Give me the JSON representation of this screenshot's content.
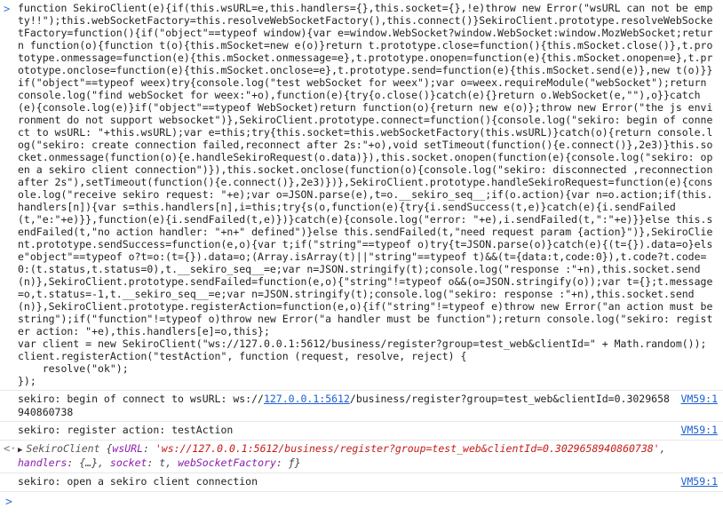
{
  "input_gutter": ">",
  "result_gutter": "<·",
  "prompt_glyph": ">",
  "code_block": "function SekiroClient(e){if(this.wsURL=e,this.handlers={},this.socket={},!e)throw new Error(\"wsURL can not be empty!!\");this.webSocketFactory=this.resolveWebSocketFactory(),this.connect()}SekiroClient.prototype.resolveWebSocketFactory=function(){if(\"object\"==typeof window){var e=window.WebSocket?window.WebSocket:window.MozWebSocket;return function(o){function t(o){this.mSocket=new e(o)}return t.prototype.close=function(){this.mSocket.close()},t.prototype.onmessage=function(e){this.mSocket.onmessage=e},t.prototype.onopen=function(e){this.mSocket.onopen=e},t.prototype.onclose=function(e){this.mSocket.onclose=e},t.prototype.send=function(e){this.mSocket.send(e)},new t(o)}}if(\"object\"==typeof weex)try{console.log(\"test webSocket for weex\");var o=weex.requireModule(\"webSocket\");return console.log(\"find webSocket for weex:\"+o),function(e){try{o.close()}catch(e){}return o.WebSocket(e,\"\"),o}}catch(e){console.log(e)}if(\"object\"==typeof WebSocket)return function(o){return new e(o)};throw new Error(\"the js environment do not support websocket\")},SekiroClient.prototype.connect=function(){console.log(\"sekiro: begin of connect to wsURL: \"+this.wsURL);var e=this;try{this.socket=this.webSocketFactory(this.wsURL)}catch(o){return console.log(\"sekiro: create connection failed,reconnect after 2s:\"+o),void setTimeout(function(){e.connect()},2e3)}this.socket.onmessage(function(o){e.handleSekiroRequest(o.data)}),this.socket.onopen(function(e){console.log(\"sekiro: open a sekiro client connection\")}),this.socket.onclose(function(o){console.log(\"sekiro: disconnected ,reconnection after 2s\"),setTimeout(function(){e.connect()},2e3)})},SekiroClient.prototype.handleSekiroRequest=function(e){console.log(\"receive sekiro request: \"+e);var o=JSON.parse(e),t=o.__sekiro_seq__;if(o.action){var n=o.action;if(this.handlers[n]){var s=this.handlers[n],i=this;try{s(o,function(e){try{i.sendSuccess(t,e)}catch(e){i.sendFailed(t,\"e:\"+e)}},function(e){i.sendFailed(t,e)})}catch(e){console.log(\"error: \"+e),i.sendFailed(t,\":\"+e)}}else this.sendFailed(t,\"no action handler: \"+n+\" defined\")}else this.sendFailed(t,\"need request param {action}\")},SekiroClient.prototype.sendSuccess=function(e,o){var t;if(\"string\"==typeof o)try{t=JSON.parse(o)}catch(e){(t={}).data=o}else\"object\"==typeof o?t=o:(t={}).data=o;(Array.isArray(t)||\"string\"==typeof t)&&(t={data:t,code:0}),t.code?t.code=0:(t.status,t.status=0),t.__sekiro_seq__=e;var n=JSON.stringify(t);console.log(\"response :\"+n),this.socket.send(n)},SekiroClient.prototype.sendFailed=function(e,o){\"string\"!=typeof o&&(o=JSON.stringify(o));var t={};t.message=o,t.status=-1,t.__sekiro_seq__=e;var n=JSON.stringify(t);console.log(\"sekiro: response :\"+n),this.socket.send(n)},SekiroClient.prototype.registerAction=function(e,o){if(\"string\"!=typeof e)throw new Error(\"an action must be string\");if(\"function\"!=typeof o)throw new Error(\"a handler must be function\");return console.log(\"sekiro: register action: \"+e),this.handlers[e]=o,this};\nvar client = new SekiroClient(\"ws://127.0.0.1:5612/business/register?group=test_web&clientId=\" + Math.random());\nclient.registerAction(\"testAction\", function (request, resolve, reject) {\n    resolve(\"ok\");\n});",
  "logs": [
    {
      "prefix": "sekiro: begin of connect to wsURL: ws://",
      "link": "127.0.0.1:5612",
      "suffix": "/business/register?group=test_web&clientId=0.3029658940860738",
      "source": "VM59:1"
    },
    {
      "prefix": "sekiro: register action: testAction",
      "link": "",
      "suffix": "",
      "source": "VM59:1"
    }
  ],
  "result": {
    "triangle": "▶",
    "class_name": "SekiroClient",
    "open": "{",
    "k1": "wsURL",
    "v1": "'ws://127.0.0.1:5612/business/register?group=test_web&clientId=0.3029658940860738'",
    "k2": "handlers",
    "v2": "{…}",
    "k3": "socket",
    "v3": "t",
    "k4": "webSocketFactory",
    "v4": "ƒ",
    "close": "}"
  },
  "last_log": {
    "text": "sekiro: open a sekiro client connection",
    "source": "VM59:1"
  }
}
